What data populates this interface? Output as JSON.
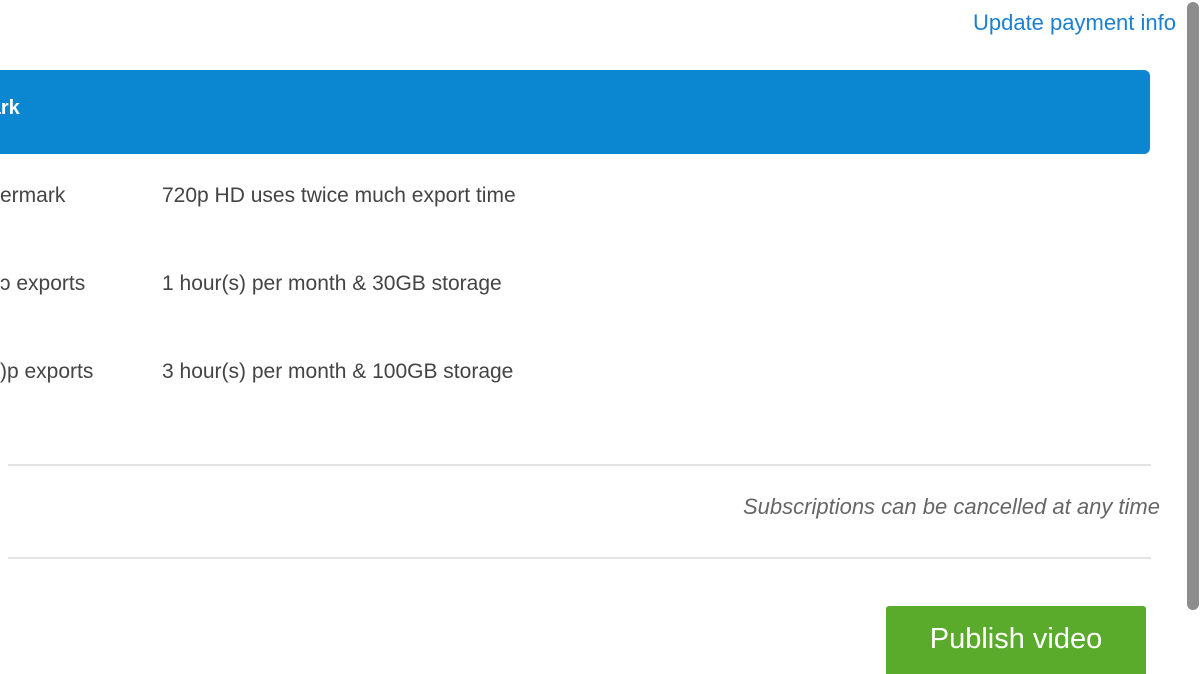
{
  "header": {
    "update_payment_link": "Update payment info"
  },
  "selected_option": {
    "label": "ermark"
  },
  "features": [
    {
      "name": "ermark",
      "description": "720p HD uses twice much export time"
    },
    {
      "name": "ɔ exports",
      "description": "1 hour(s) per month & 30GB storage"
    },
    {
      "name": ")p exports",
      "description": "3 hour(s) per month & 100GB storage"
    }
  ],
  "footer": {
    "cancel_note": "Subscriptions can be cancelled at any time",
    "publish_button": "Publish video"
  },
  "colors": {
    "accent_blue": "#0a87d0",
    "link_blue": "#1c7fcf",
    "publish_green": "#5aaa2b"
  }
}
